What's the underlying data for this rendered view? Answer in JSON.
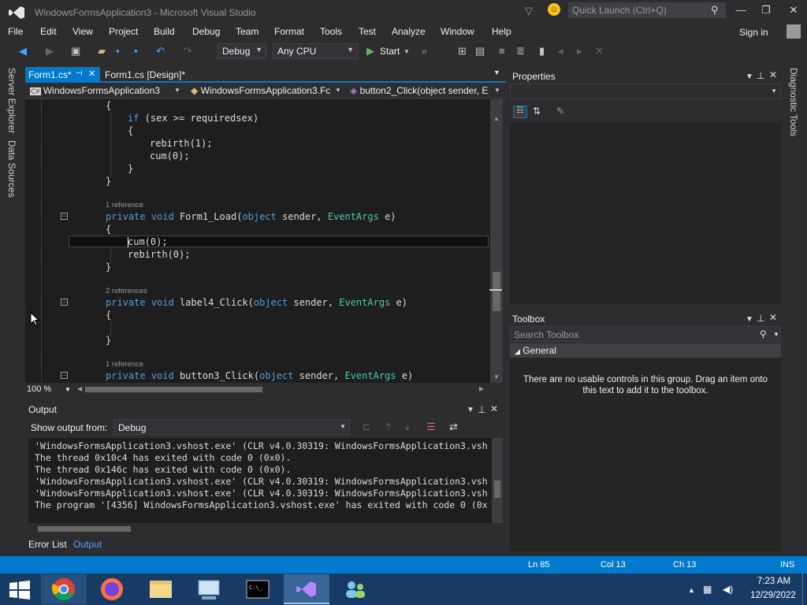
{
  "window": {
    "title": "WindowsFormsApplication3 - Microsoft Visual Studio",
    "quick_launch_placeholder": "Quick Launch (Ctrl+Q)"
  },
  "menu": [
    "File",
    "Edit",
    "View",
    "Project",
    "Build",
    "Debug",
    "Team",
    "Format",
    "Tools",
    "Test",
    "Analyze",
    "Window",
    "Help"
  ],
  "signin_label": "Sign in",
  "toolbar": {
    "config": "Debug",
    "platform": "Any CPU",
    "start_label": "Start"
  },
  "side_tabs": {
    "server_explorer": "Server Explorer",
    "data_sources": "Data Sources",
    "diagnostic_tools": "Diagnostic Tools"
  },
  "doc_tabs": [
    {
      "label": "Form1.cs*",
      "active": true
    },
    {
      "label": "Form1.cs [Design]*",
      "active": false
    }
  ],
  "nav": {
    "project": "WindowsFormsApplication3",
    "class": "WindowsFormsApplication3.Fc",
    "member": "button2_Click(object sender, E"
  },
  "code": {
    "lines": {
      "l1": "{",
      "l2_kw": "if",
      "l2_rest": " (sex >= requiredsex)",
      "l3": "{",
      "l4": "rebirth(1);",
      "l5": "cum(0);",
      "l6": "}",
      "l7": "}",
      "ref1": "1 reference",
      "m1_private": "private",
      "m1_void": "void",
      "m1_name": " Form1_Load(",
      "m1_object": "object",
      "m1_sender": " sender, ",
      "m1_type": "EventArgs",
      "m1_end": " e)",
      "l9": "{",
      "l10": "cum(0);",
      "l11": "rebirth(0);",
      "l12": "}",
      "ref2": "2 references",
      "m2_private": "private",
      "m2_void": "void",
      "m2_name": " label4_Click(",
      "m2_object": "object",
      "m2_sender": " sender, ",
      "m2_type": "EventArgs",
      "m2_end": " e)",
      "l14": "{",
      "l15": "}",
      "ref3": "1 reference",
      "m3_private": "private",
      "m3_void": "void",
      "m3_name": " button3_Click(",
      "m3_object": "object",
      "m3_sender": " sender, ",
      "m3_type": "EventArgs",
      "m3_end": " e)"
    }
  },
  "zoom": "100 %",
  "output": {
    "title": "Output",
    "show_from_label": "Show output from:",
    "source": "Debug",
    "lines": [
      "'WindowsFormsApplication3.vshost.exe' (CLR v4.0.30319: WindowsFormsApplication3.vsh",
      "The thread 0x10c4 has exited with code 0 (0x0).",
      "The thread 0x146c has exited with code 0 (0x0).",
      "'WindowsFormsApplication3.vshost.exe' (CLR v4.0.30319: WindowsFormsApplication3.vsh",
      "'WindowsFormsApplication3.vshost.exe' (CLR v4.0.30319: WindowsFormsApplication3.vsh",
      "The program '[4356] WindowsFormsApplication3.vshost.exe' has exited with code 0 (0x"
    ]
  },
  "bottom_tabs": {
    "error_list": "Error List",
    "output": "Output"
  },
  "properties": {
    "title": "Properties"
  },
  "toolbox": {
    "title": "Toolbox",
    "search_placeholder": "Search Toolbox",
    "group": "General",
    "empty_text": "There are no usable controls in this group. Drag an item onto this text to add it to the toolbox."
  },
  "status": {
    "ln": "Ln 85",
    "col": "Col 13",
    "ch": "Ch 13",
    "mode": "INS"
  },
  "taskbar": {
    "time": "7:23 AM",
    "date": "12/29/2022"
  },
  "colors": {
    "accent": "#007acc",
    "keyword": "#569cd6",
    "type": "#4ec9b0",
    "taskbar": "#183b66"
  }
}
